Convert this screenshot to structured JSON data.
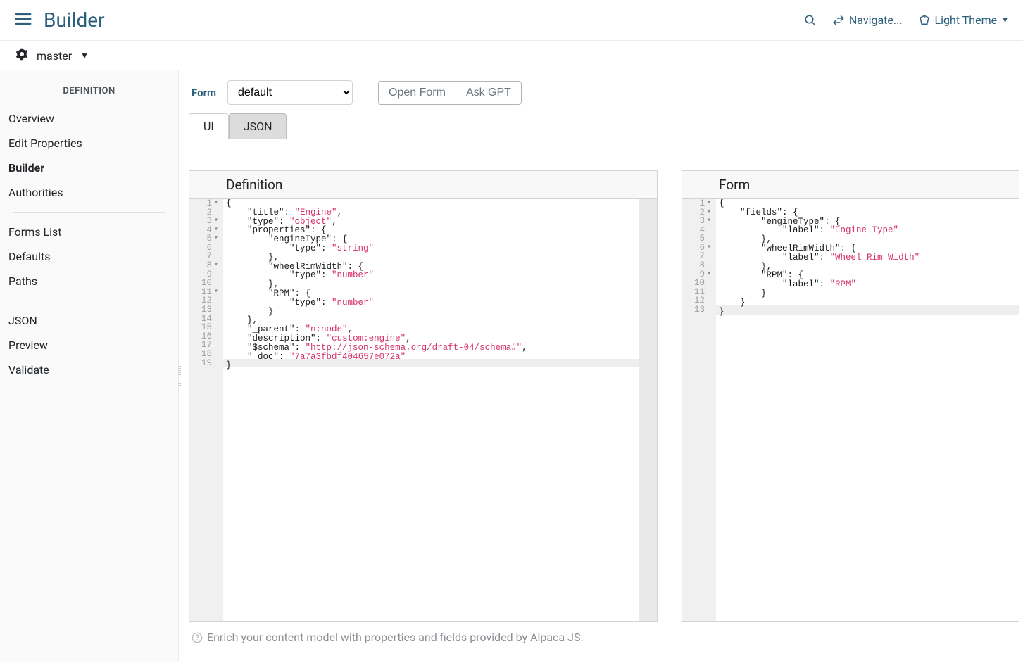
{
  "header": {
    "title": "Builder",
    "navigate": "Navigate...",
    "theme": "Light Theme"
  },
  "branch": "master",
  "sidebar": {
    "heading": "DEFINITION",
    "items1": [
      {
        "label": "Overview"
      },
      {
        "label": "Edit Properties"
      },
      {
        "label": "Builder"
      },
      {
        "label": "Authorities"
      }
    ],
    "items2": [
      {
        "label": "Forms List"
      },
      {
        "label": "Defaults"
      },
      {
        "label": "Paths"
      }
    ],
    "items3": [
      {
        "label": "JSON"
      },
      {
        "label": "Preview"
      },
      {
        "label": "Validate"
      }
    ]
  },
  "formbar": {
    "label": "Form",
    "selected": "default",
    "openForm": "Open Form",
    "askGpt": "Ask GPT"
  },
  "tabs": {
    "ui": "UI",
    "json": "JSON"
  },
  "panels": {
    "definition": "Definition",
    "form": "Form"
  },
  "hint": "Enrich your content model with properties and fields provided by Alpaca JS.",
  "editor_definition": {
    "line_count": 19,
    "fold_lines": [
      1,
      3,
      4,
      5,
      8,
      11
    ],
    "highlight_line": 19,
    "tokens": [
      [
        [
          "p",
          "{"
        ]
      ],
      [
        [
          "p",
          "    "
        ],
        [
          "k",
          "\"title\""
        ],
        [
          "p",
          ": "
        ],
        [
          "s",
          "\"Engine\""
        ],
        [
          "p",
          ","
        ]
      ],
      [
        [
          "p",
          "    "
        ],
        [
          "k",
          "\"type\""
        ],
        [
          "p",
          ": "
        ],
        [
          "s",
          "\"object\""
        ],
        [
          "p",
          ","
        ]
      ],
      [
        [
          "p",
          "    "
        ],
        [
          "k",
          "\"properties\""
        ],
        [
          "p",
          ": {"
        ]
      ],
      [
        [
          "p",
          "        "
        ],
        [
          "k",
          "\"engineType\""
        ],
        [
          "p",
          ": {"
        ]
      ],
      [
        [
          "p",
          "            "
        ],
        [
          "k",
          "\"type\""
        ],
        [
          "p",
          ": "
        ],
        [
          "s",
          "\"string\""
        ]
      ],
      [
        [
          "p",
          "        },"
        ]
      ],
      [
        [
          "p",
          "        "
        ],
        [
          "k",
          "\"wheelRimWidth\""
        ],
        [
          "p",
          ": {"
        ]
      ],
      [
        [
          "p",
          "            "
        ],
        [
          "k",
          "\"type\""
        ],
        [
          "p",
          ": "
        ],
        [
          "s",
          "\"number\""
        ]
      ],
      [
        [
          "p",
          "        },"
        ]
      ],
      [
        [
          "p",
          "        "
        ],
        [
          "k",
          "\"RPM\""
        ],
        [
          "p",
          ": {"
        ]
      ],
      [
        [
          "p",
          "            "
        ],
        [
          "k",
          "\"type\""
        ],
        [
          "p",
          ": "
        ],
        [
          "s",
          "\"number\""
        ]
      ],
      [
        [
          "p",
          "        }"
        ]
      ],
      [
        [
          "p",
          "    },"
        ]
      ],
      [
        [
          "p",
          "    "
        ],
        [
          "k",
          "\"_parent\""
        ],
        [
          "p",
          ": "
        ],
        [
          "s",
          "\"n:node\""
        ],
        [
          "p",
          ","
        ]
      ],
      [
        [
          "p",
          "    "
        ],
        [
          "k",
          "\"description\""
        ],
        [
          "p",
          ": "
        ],
        [
          "s",
          "\"custom:engine\""
        ],
        [
          "p",
          ","
        ]
      ],
      [
        [
          "p",
          "    "
        ],
        [
          "k",
          "\"$schema\""
        ],
        [
          "p",
          ": "
        ],
        [
          "s",
          "\"http://json-schema.org/draft-04/schema#\""
        ],
        [
          "p",
          ","
        ]
      ],
      [
        [
          "p",
          "    "
        ],
        [
          "k",
          "\"_doc\""
        ],
        [
          "p",
          ": "
        ],
        [
          "s",
          "\"7a7a3fbdf404657e072a\""
        ]
      ],
      [
        [
          "p",
          "}"
        ]
      ]
    ]
  },
  "editor_form": {
    "line_count": 13,
    "fold_lines": [
      1,
      2,
      3,
      6,
      9
    ],
    "highlight_line": 13,
    "tokens": [
      [
        [
          "p",
          "{"
        ]
      ],
      [
        [
          "p",
          "    "
        ],
        [
          "k",
          "\"fields\""
        ],
        [
          "p",
          ": {"
        ]
      ],
      [
        [
          "p",
          "        "
        ],
        [
          "k",
          "\"engineType\""
        ],
        [
          "p",
          ": {"
        ]
      ],
      [
        [
          "p",
          "            "
        ],
        [
          "k",
          "\"label\""
        ],
        [
          "p",
          ": "
        ],
        [
          "s",
          "\"Engine Type\""
        ]
      ],
      [
        [
          "p",
          "        },"
        ]
      ],
      [
        [
          "p",
          "        "
        ],
        [
          "k",
          "\"wheelRimWidth\""
        ],
        [
          "p",
          ": {"
        ]
      ],
      [
        [
          "p",
          "            "
        ],
        [
          "k",
          "\"label\""
        ],
        [
          "p",
          ": "
        ],
        [
          "s",
          "\"Wheel Rim Width\""
        ]
      ],
      [
        [
          "p",
          "        },"
        ]
      ],
      [
        [
          "p",
          "        "
        ],
        [
          "k",
          "\"RPM\""
        ],
        [
          "p",
          ": {"
        ]
      ],
      [
        [
          "p",
          "            "
        ],
        [
          "k",
          "\"label\""
        ],
        [
          "p",
          ": "
        ],
        [
          "s",
          "\"RPM\""
        ]
      ],
      [
        [
          "p",
          "        }"
        ]
      ],
      [
        [
          "p",
          "    }"
        ]
      ],
      [
        [
          "p",
          "}"
        ]
      ]
    ]
  }
}
